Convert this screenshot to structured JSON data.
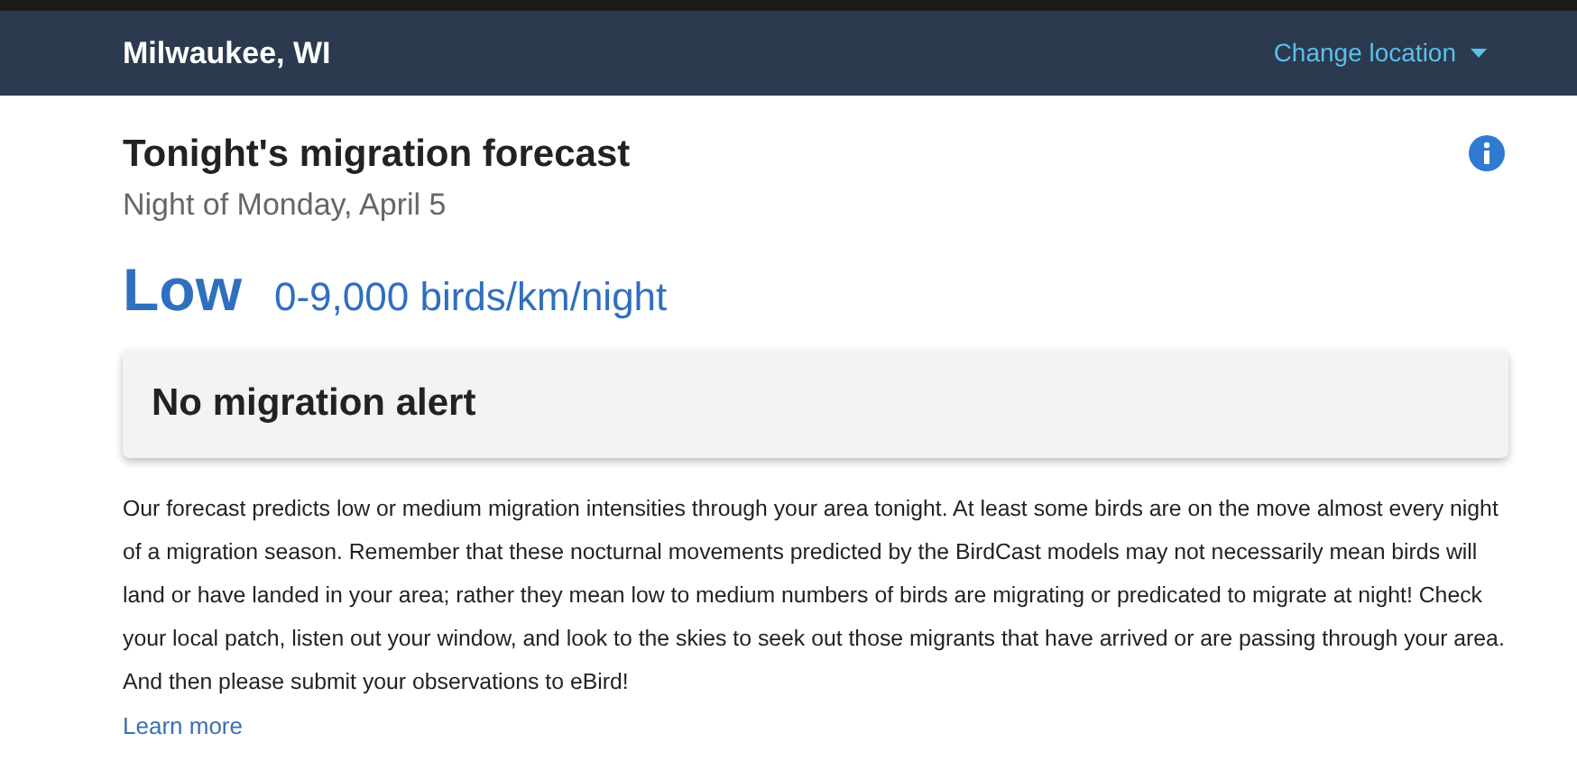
{
  "header": {
    "location": "Milwaukee, WI",
    "change_location": "Change location"
  },
  "forecast": {
    "title": "Tonight's migration forecast",
    "date": "Night of Monday, April 5",
    "level": "Low",
    "range": "0-9,000 birds/km/night"
  },
  "alert": {
    "title": "No migration alert"
  },
  "description": "Our forecast predicts low or medium migration intensities through your area tonight. At least some birds are on the move almost every night of a migration season. Remember that these nocturnal movements predicted by the BirdCast models may not necessarily mean birds will land or have landed in your area; rather they mean low to medium numbers of birds are migrating or predicated to migrate at night! Check your local patch, listen out your window, and look to the skies to seek out those migrants that have arrived or are passing through your area. And then please submit your observations to eBird!",
  "learn_more": "Learn more"
}
